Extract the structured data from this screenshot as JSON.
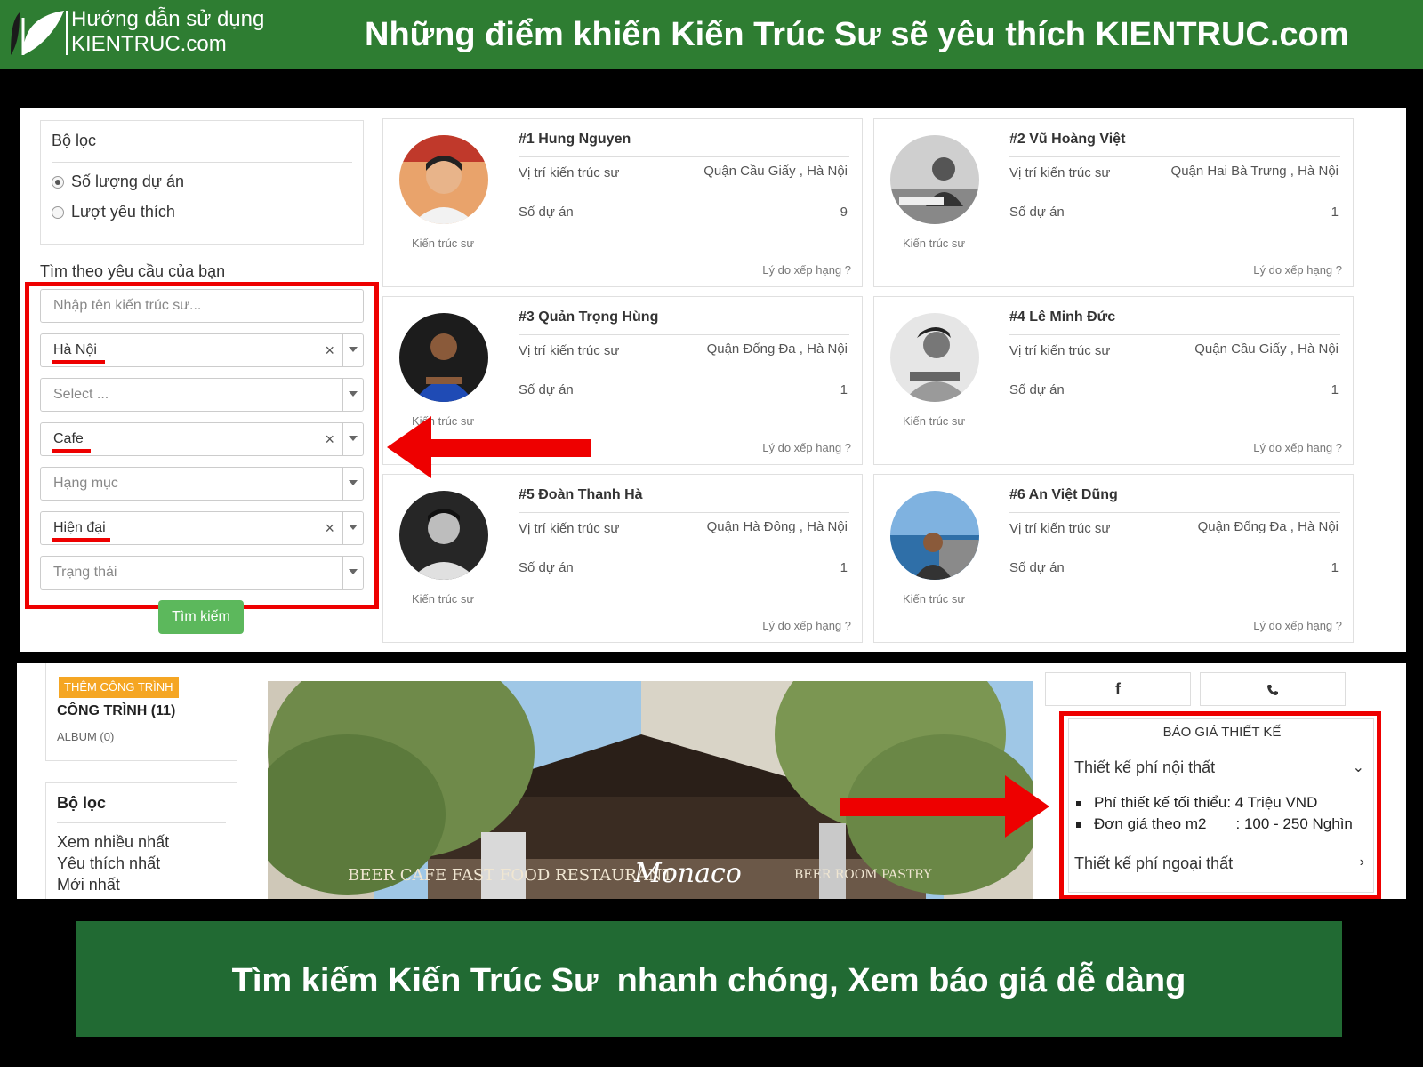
{
  "header": {
    "logo_line1": "Hướng dẫn sử dụng",
    "logo_line2": "KIENTRUC.com",
    "title": "Những điểm khiến Kiến Trúc Sư sẽ yêu thích KIENTRUC.com"
  },
  "filter": {
    "title": "Bộ lọc",
    "options": [
      "Số lượng dự án",
      "Lượt yêu thích"
    ],
    "selected_index": 0
  },
  "search": {
    "label": "Tìm theo yêu cầu của bạn",
    "name_placeholder": "Nhập tên kiến trúc sư...",
    "city": "Hà Nội",
    "district_placeholder": "Select ...",
    "type": "Cafe",
    "category_placeholder": "Hạng mục",
    "style": "Hiện đại",
    "status_placeholder": "Trạng thái",
    "button": "Tìm kiếm"
  },
  "architects": [
    {
      "name": "#1 Hung Nguyen",
      "position_label": "Vị trí kiến trúc sư",
      "location": "Quận Cầu Giấy , Hà Nội",
      "projects_label": "Số dự án",
      "projects": "9",
      "role": "Kiến trúc sư",
      "why": "Lý do xếp hạng ?"
    },
    {
      "name": "#2 Vũ Hoàng Việt",
      "position_label": "Vị trí kiến trúc sư",
      "location": "Quận Hai Bà Trưng , Hà Nội",
      "projects_label": "Số dự án",
      "projects": "1",
      "role": "Kiến trúc sư",
      "why": "Lý do xếp hạng ?"
    },
    {
      "name": "#3 Quản Trọng Hùng",
      "position_label": "Vị trí kiến trúc sư",
      "location": "Quận Đống Đa , Hà Nội",
      "projects_label": "Số dự án",
      "projects": "1",
      "role": "Kiến trúc sư",
      "why": "Lý do xếp hạng ?"
    },
    {
      "name": "#4 Lê Minh Đức",
      "position_label": "Vị trí kiến trúc sư",
      "location": "Quận Cầu Giấy , Hà Nội",
      "projects_label": "Số dự án",
      "projects": "1",
      "role": "Kiến trúc sư",
      "why": "Lý do xếp hạng ?"
    },
    {
      "name": "#5 Đoàn Thanh Hà",
      "position_label": "Vị trí kiến trúc sư",
      "location": "Quận Hà Đông , Hà Nội",
      "projects_label": "Số dự án",
      "projects": "1",
      "role": "Kiến trúc sư",
      "why": "Lý do xếp hạng ?"
    },
    {
      "name": "#6 An Việt Dũng",
      "position_label": "Vị trí kiến trúc sư",
      "location": "Quận Đống Đa , Hà Nội",
      "projects_label": "Số dự án",
      "projects": "1",
      "role": "Kiến trúc sư",
      "why": "Lý do xếp hạng ?"
    }
  ],
  "profile": {
    "add_button": "THÊM CÔNG TRÌNH",
    "projects_title": "CÔNG TRÌNH (11)",
    "album": "ALBUM (0)",
    "filter_title": "Bộ lọc",
    "filter_options": [
      "Xem nhiều nhất",
      "Yêu thích nhất",
      "Mới nhất"
    ],
    "photo_sign": "BEER  CAFE  FAST FOOD  RESTAURANT",
    "photo_brand": "Monaco",
    "photo_sign_right": "BEER  ROOM  PASTRY"
  },
  "quote": {
    "facebook_icon": "f",
    "phone_icon": "phone-icon",
    "title": "BÁO GIÁ THIẾT KẾ",
    "interior_label": "Thiết kế phí nội thất",
    "min_fee": "Phí thiết kế tối thiểu: 4 Triệu VND",
    "unit_price": "Đơn giá theo m2       : 100 - 250 Nghìn",
    "exterior_label": "Thiết kế phí ngoại thất"
  },
  "footer": {
    "caption": "Tìm kiếm Kiến Trúc Sư  nhanh chóng, Xem báo giá dễ dàng"
  },
  "colors": {
    "header_green": "#2e7d32",
    "footer_green": "#216a33",
    "highlight_red": "#e00000",
    "button_green": "#5cb85c",
    "add_orange": "#f5a623"
  }
}
